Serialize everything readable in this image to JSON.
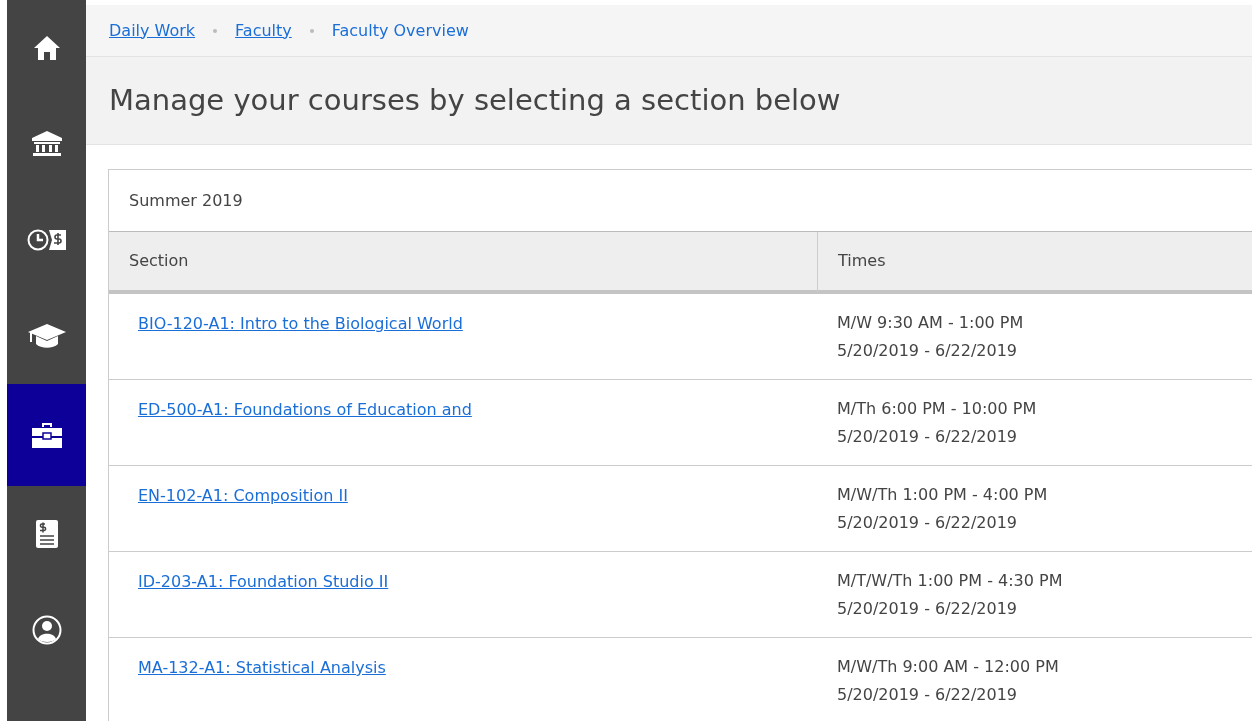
{
  "sidebar": {
    "items": [
      {
        "kind": "home",
        "selected": false
      },
      {
        "kind": "bank",
        "selected": false
      },
      {
        "kind": "clock-dollar",
        "selected": false
      },
      {
        "kind": "cap",
        "selected": false
      },
      {
        "kind": "briefcase",
        "selected": true
      },
      {
        "kind": "bill",
        "selected": false
      },
      {
        "kind": "user",
        "selected": false
      }
    ]
  },
  "breadcrumb": [
    {
      "label": "Daily Work",
      "link": true
    },
    {
      "label": "Faculty",
      "link": true
    },
    {
      "label": "Faculty Overview",
      "link": false
    }
  ],
  "title": "Manage your courses by selecting a section below",
  "term": "Summer 2019",
  "table": {
    "columns": [
      "Section",
      "Times"
    ],
    "rows": [
      {
        "section": "BIO-120-A1: Intro to the Biological World",
        "times": [
          "M/W 9:30 AM - 1:00 PM",
          "5/20/2019 - 6/22/2019"
        ]
      },
      {
        "section": "ED-500-A1: Foundations of Education and",
        "times": [
          "M/Th 6:00 PM - 10:00 PM",
          "5/20/2019 - 6/22/2019"
        ]
      },
      {
        "section": "EN-102-A1: Composition II",
        "times": [
          "M/W/Th 1:00 PM - 4:00 PM",
          "5/20/2019 - 6/22/2019"
        ]
      },
      {
        "section": "ID-203-A1: Foundation Studio II",
        "times": [
          "M/T/W/Th 1:00 PM - 4:30 PM",
          "5/20/2019 - 6/22/2019"
        ]
      },
      {
        "section": "MA-132-A1: Statistical Analysis",
        "times": [
          "M/W/Th 9:00 AM - 12:00 PM",
          "5/20/2019 - 6/22/2019"
        ]
      }
    ]
  }
}
